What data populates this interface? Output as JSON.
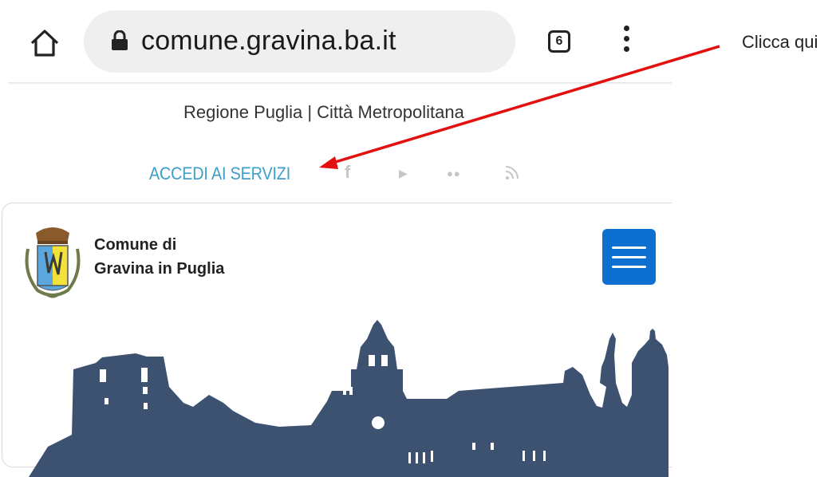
{
  "browser": {
    "url": "comune.gravina.ba.it",
    "tab_count": "6"
  },
  "page": {
    "region_line": "Regione Puglia | Città Metropolitana",
    "services_link": "ACCEDI AI SERVIZI",
    "social_icons": [
      "facebook-icon",
      "youtube-icon",
      "flickr-icon",
      "rss-icon"
    ],
    "brand_line1": "Comune di",
    "brand_line2": "Gravina in Puglia"
  },
  "annotation": {
    "text": "Clicca qui",
    "arrow_color": "#e31010"
  },
  "colors": {
    "link": "#3b9fc9",
    "menu_button": "#0d6fd0",
    "skyline": "#3d5170"
  }
}
